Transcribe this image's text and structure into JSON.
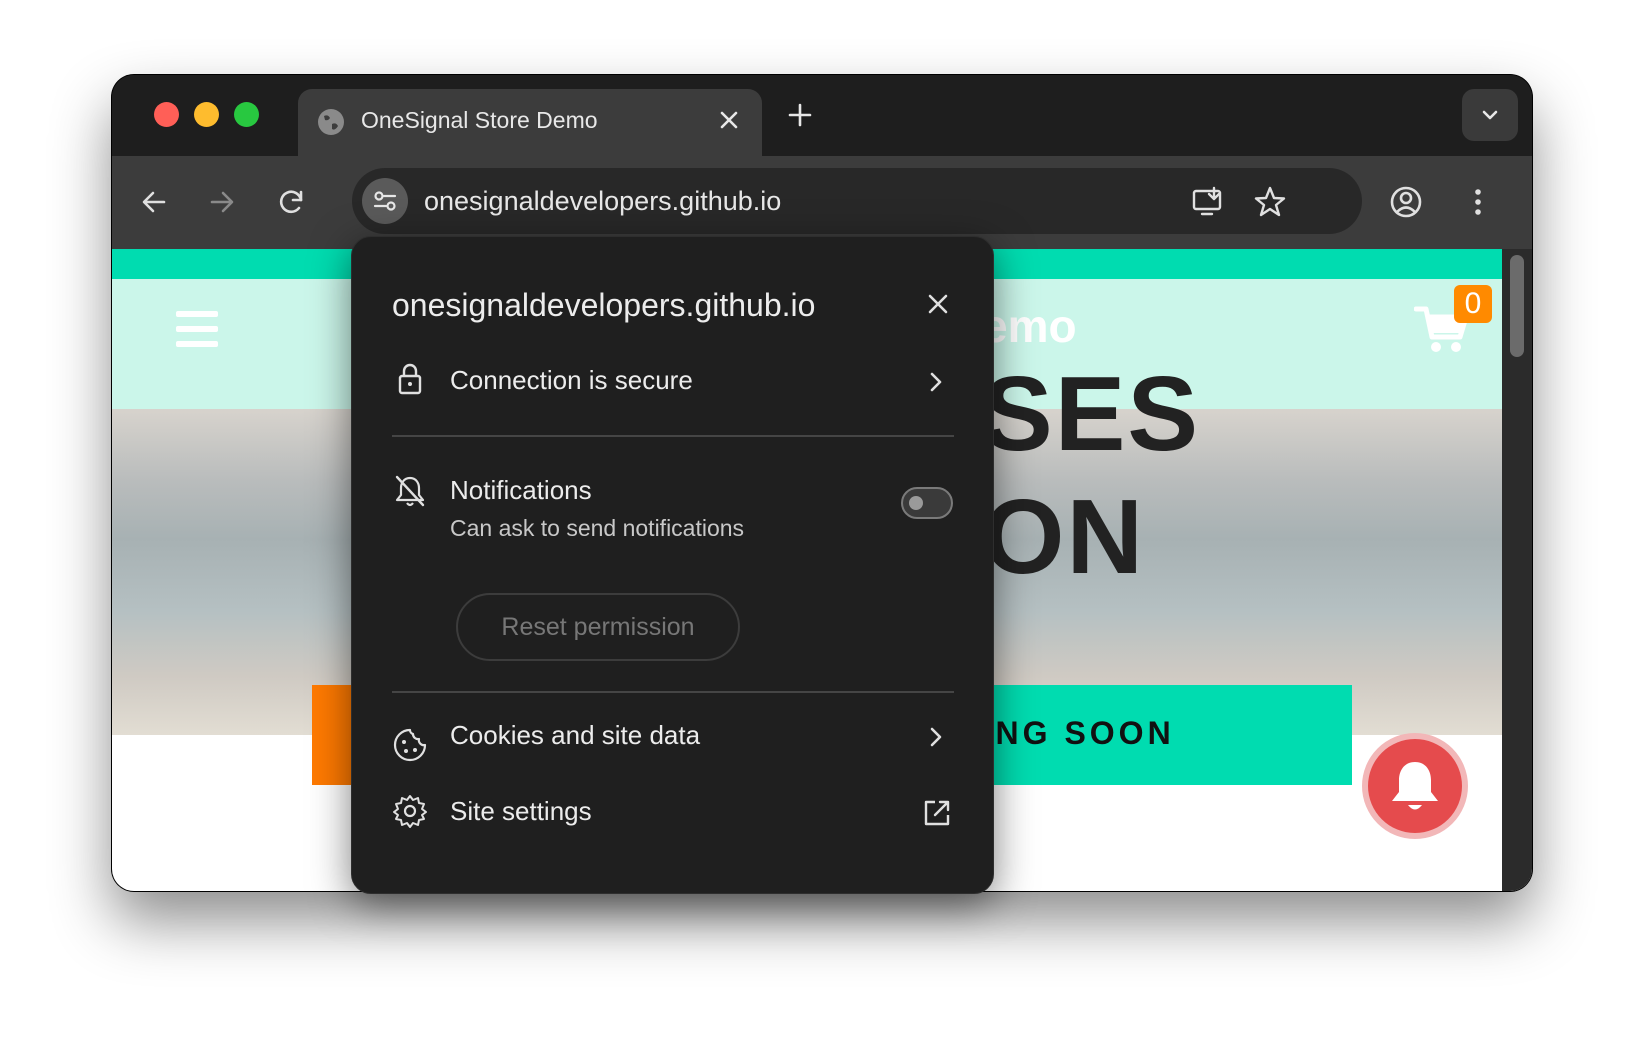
{
  "browser": {
    "tab_title": "OneSignal Store Demo",
    "url": "onesignaldevelopers.github.io"
  },
  "page": {
    "brand_fragment": "emo",
    "hero_line1": "SES",
    "hero_line2": "ON",
    "cart_count": "0",
    "cta_label": "MING SOON",
    "colors": {
      "teal": "#00dcb0",
      "mint": "#cbf6ea",
      "orange": "#ff7a00",
      "bell_red": "#e54b4d"
    }
  },
  "popup": {
    "title": "onesignaldevelopers.github.io",
    "connection_label": "Connection is secure",
    "notifications_label": "Notifications",
    "notifications_sub": "Can ask to send notifications",
    "notifications_enabled": false,
    "reset_label": "Reset permission",
    "cookies_label": "Cookies and site data",
    "site_settings_label": "Site settings"
  },
  "icons": [
    "globe-icon",
    "close-icon",
    "plus-icon",
    "chevron-down-icon",
    "back-icon",
    "forward-icon",
    "reload-icon",
    "site-info-icon",
    "install-icon",
    "star-icon",
    "profile-icon",
    "more-icon",
    "menu-icon",
    "cart-icon",
    "bell-icon",
    "lock-icon",
    "chevron-right-icon",
    "bell-off-icon",
    "cookie-icon",
    "gear-icon",
    "external-link-icon"
  ]
}
